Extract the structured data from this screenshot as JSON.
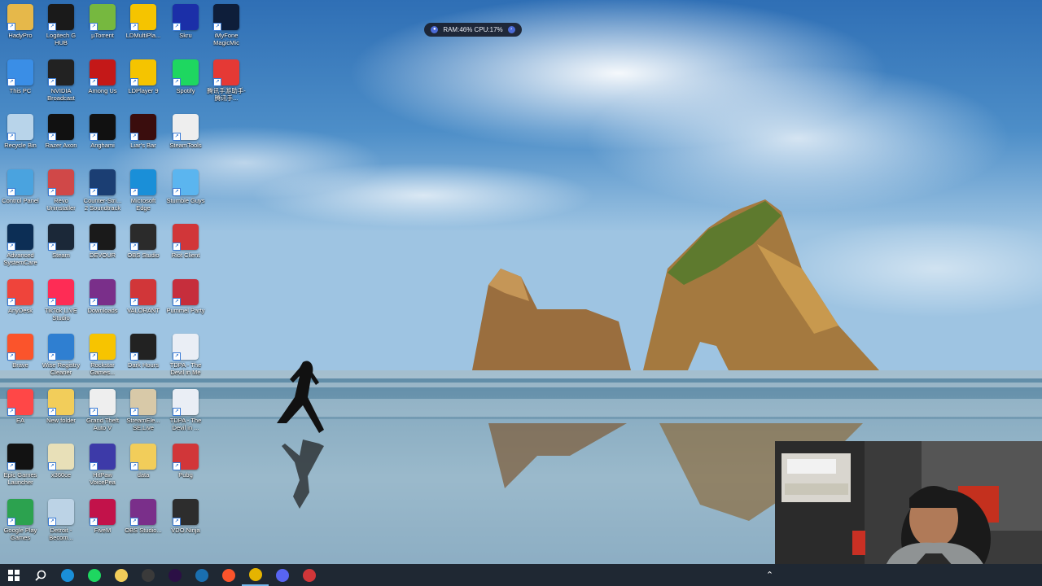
{
  "desktop_icons": [
    {
      "label": "HadyPro",
      "icon": "folder-user-icon",
      "color": "#e6b84a"
    },
    {
      "label": "Logitech G HUB",
      "icon": "logitech-g-icon",
      "color": "#1a1a1a"
    },
    {
      "label": "µTorrent",
      "icon": "utorrent-icon",
      "color": "#76b83f"
    },
    {
      "label": "LDMultiPla...",
      "icon": "ldmultiplayer-icon",
      "color": "#f5c400"
    },
    {
      "label": "Skru",
      "icon": "skru-icon",
      "color": "#1b2fa8"
    },
    {
      "label": "iMyFone MagicMic",
      "icon": "magicmic-icon",
      "color": "#0e1e3a"
    },
    {
      "label": "This PC",
      "icon": "computer-icon",
      "color": "#3a8ee6"
    },
    {
      "label": "NVIDIA Broadcast",
      "icon": "nvidia-icon",
      "color": "#222222"
    },
    {
      "label": "Among Us",
      "icon": "among-us-icon",
      "color": "#c41818"
    },
    {
      "label": "LDPlayer 9",
      "icon": "ldplayer-icon",
      "color": "#f5c400"
    },
    {
      "label": "Spotify",
      "icon": "spotify-icon",
      "color": "#1ed760"
    },
    {
      "label": "腾讯手游助手-腾讯手...",
      "icon": "tencent-gaming-icon",
      "color": "#e53935"
    },
    {
      "label": "Recycle Bin",
      "icon": "recycle-bin-icon",
      "color": "#b8d4ea"
    },
    {
      "label": "Razer Axon",
      "icon": "razer-axon-icon",
      "color": "#111111"
    },
    {
      "label": "Anghami",
      "icon": "anghami-icon",
      "color": "#111111"
    },
    {
      "label": "Liar's Bar",
      "icon": "liars-bar-icon",
      "color": "#3a0d0d"
    },
    {
      "label": "SteamTools",
      "icon": "steamtools-icon",
      "color": "#eeeeee"
    },
    {
      "label": "",
      "icon": "",
      "color": ""
    },
    {
      "label": "Control Panel",
      "icon": "control-panel-icon",
      "color": "#4aa3df"
    },
    {
      "label": "Revo Uninstaller",
      "icon": "revo-uninstaller-icon",
      "color": "#d04848"
    },
    {
      "label": "Counter-Stri... 2 Soundtrack",
      "icon": "music-note-icon",
      "color": "#1b3e73"
    },
    {
      "label": "Microsoft Edge",
      "icon": "edge-icon",
      "color": "#1a8fd8"
    },
    {
      "label": "Stumble Guys",
      "icon": "stumble-guys-icon",
      "color": "#5bb5ef"
    },
    {
      "label": "",
      "icon": "",
      "color": ""
    },
    {
      "label": "Advanced SystemCare",
      "icon": "systemcare-icon",
      "color": "#0c2e55"
    },
    {
      "label": "Steam",
      "icon": "steam-icon",
      "color": "#1b2838"
    },
    {
      "label": "DEVOUR",
      "icon": "devour-icon",
      "color": "#1a1a1a"
    },
    {
      "label": "OBS Studio",
      "icon": "obs-icon",
      "color": "#2b2b2b"
    },
    {
      "label": "Riot Client",
      "icon": "riot-client-icon",
      "color": "#d13639"
    },
    {
      "label": "",
      "icon": "",
      "color": ""
    },
    {
      "label": "AnyDesk",
      "icon": "anydesk-icon",
      "color": "#ef443b"
    },
    {
      "label": "TikTok LIVE Studio",
      "icon": "tiktok-icon",
      "color": "#fe2c55"
    },
    {
      "label": "Downloads",
      "icon": "winrar-icon",
      "color": "#7a2f8a"
    },
    {
      "label": "VALORANT",
      "icon": "valorant-icon",
      "color": "#d13639"
    },
    {
      "label": "Pummel Party",
      "icon": "pummel-party-icon",
      "color": "#c62e3c"
    },
    {
      "label": "",
      "icon": "",
      "color": ""
    },
    {
      "label": "Brave",
      "icon": "brave-icon",
      "color": "#fb542b"
    },
    {
      "label": "Wise Registry Cleaner",
      "icon": "wise-registry-icon",
      "color": "#2f7fd1"
    },
    {
      "label": "Rockstar Games...",
      "icon": "rockstar-icon",
      "color": "#f7c400"
    },
    {
      "label": "Dark Hours",
      "icon": "dark-hours-icon",
      "color": "#222222"
    },
    {
      "label": "TDPA - The Devil in Me",
      "icon": "tdpa-icon",
      "color": "#eaeef5"
    },
    {
      "label": "",
      "icon": "",
      "color": ""
    },
    {
      "label": "EA",
      "icon": "ea-icon",
      "color": "#ff4747"
    },
    {
      "label": "New folder",
      "icon": "folder-icon",
      "color": "#f2cd5a"
    },
    {
      "label": "Grand Theft Auto V",
      "icon": "gta-icon",
      "color": "#eeeeee"
    },
    {
      "label": "StreamEle... SE.Live",
      "icon": "streamelements-icon",
      "color": "#d8c9a8"
    },
    {
      "label": "TDPA - The Devil in ...",
      "icon": "tdpa-icon",
      "color": "#eaeef5"
    },
    {
      "label": "",
      "icon": "",
      "color": ""
    },
    {
      "label": "Epic Games Launcher",
      "icon": "epic-games-icon",
      "color": "#121212"
    },
    {
      "label": "x360ce",
      "icon": "x360ce-icon",
      "color": "#e8e0b8"
    },
    {
      "label": "HitPaw VoicePea",
      "icon": "hitpaw-icon",
      "color": "#3d3aa8"
    },
    {
      "label": "data",
      "icon": "folder-icon",
      "color": "#f2cd5a"
    },
    {
      "label": "Pubg",
      "icon": "pubg-icon",
      "color": "#d13639"
    },
    {
      "label": "",
      "icon": "",
      "color": ""
    },
    {
      "label": "Google Play Games",
      "icon": "google-play-games-icon",
      "color": "#2ca24f"
    },
    {
      "label": "Detroit - Becom...",
      "icon": "detroit-icon",
      "color": "#bcd3e6"
    },
    {
      "label": "FiveM",
      "icon": "fivem-icon",
      "color": "#c2124a"
    },
    {
      "label": "OBS Studio...",
      "icon": "winrar-icon",
      "color": "#7a2f8a"
    },
    {
      "label": "VDO.Ninja",
      "icon": "vdo-ninja-icon",
      "color": "#2d2d2d"
    }
  ],
  "perf_widget": {
    "text": "RAM:46%  CPU:17%"
  },
  "taskbar": {
    "items": [
      {
        "icon": "windows-start-icon",
        "color": "#ffffff"
      },
      {
        "icon": "search-icon",
        "color": "#ffffff"
      },
      {
        "icon": "edge-icon",
        "color": "#1a8fd8"
      },
      {
        "icon": "spotify-icon",
        "color": "#1ed760"
      },
      {
        "icon": "file-explorer-icon",
        "color": "#f2cd5a"
      },
      {
        "icon": "obs-icon",
        "color": "#3a3a3a"
      },
      {
        "icon": "premiere-pro-icon",
        "color": "#2b0f45"
      },
      {
        "icon": "ccleaner-icon",
        "color": "#1a6fb0"
      },
      {
        "icon": "brave-icon",
        "color": "#fb542b"
      },
      {
        "icon": "chrome-icon",
        "color": "#e5b400"
      },
      {
        "icon": "discord-icon",
        "color": "#5865f2"
      },
      {
        "icon": "steam-tool-icon",
        "color": "#d13639"
      }
    ],
    "tray_icon": "chevron-up-icon"
  },
  "colors": {
    "taskbar": "#1f2833",
    "label_text": "#ffffff"
  }
}
